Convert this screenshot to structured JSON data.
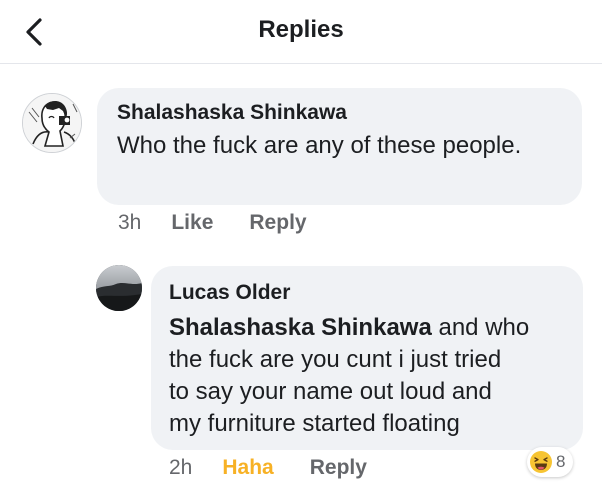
{
  "header": {
    "title": "Replies",
    "back_icon": "chevron-left-icon"
  },
  "comments": [
    {
      "author": "Shalashaska Shinkawa",
      "text": "Who the fuck are any of these people.",
      "time": "3h",
      "like_label": "Like",
      "reply_label": "Reply"
    },
    {
      "author": "Lucas Older",
      "mention": "Shalashaska Shinkawa",
      "text_line1": " and who",
      "text_line2": "the fuck are you cunt i just tried",
      "text_line3": "to say your name out loud and",
      "text_line4": "my furniture started floating",
      "time": "2h",
      "reaction_label": "Haha",
      "reply_label": "Reply",
      "reaction_icon": "haha-emoji-icon",
      "reaction_count": "8"
    }
  ],
  "colors": {
    "bubble": "#f0f2f5",
    "meta_text": "#65676b",
    "haha": "#f7b125",
    "text": "#1c1e21"
  }
}
